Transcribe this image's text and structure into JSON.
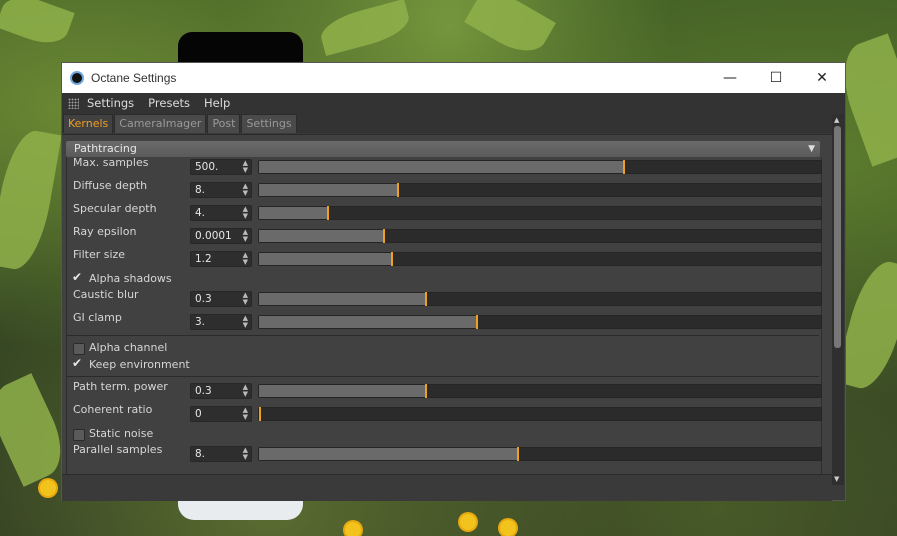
{
  "window": {
    "title": "Octane Settings",
    "minimize_icon": "minimize-icon",
    "maximize_icon": "maximize-icon",
    "close_icon": "close-icon"
  },
  "menu": [
    "Settings",
    "Presets",
    "Help"
  ],
  "tabs": [
    {
      "label": "Kernels",
      "active": true
    },
    {
      "label": "CameraImager",
      "active": false
    },
    {
      "label": "Post",
      "active": false
    },
    {
      "label": "Settings",
      "active": false
    }
  ],
  "group": {
    "title": "Pathtracing"
  },
  "params": {
    "max_samples": {
      "label": "Max. samples",
      "value": "500.",
      "fill": 0.65
    },
    "diffuse_depth": {
      "label": "Diffuse depth",
      "value": "8.",
      "fill": 0.247
    },
    "specular_depth": {
      "label": "Specular depth",
      "value": "4.",
      "fill": 0.123
    },
    "ray_epsilon": {
      "label": "Ray epsilon",
      "value": "0.0001",
      "fill": 0.222
    },
    "filter_size": {
      "label": "Filter size",
      "value": "1.2",
      "fill": 0.237
    },
    "caustic_blur": {
      "label": "Caustic blur",
      "value": "0.3",
      "fill": 0.297
    },
    "gi_clamp": {
      "label": "GI clamp",
      "value": "3.",
      "fill": 0.388
    },
    "path_term": {
      "label": "Path term. power",
      "value": "0.3",
      "fill": 0.297
    },
    "coherent_ratio": {
      "label": "Coherent ratio",
      "value": "0",
      "fill": 0.0
    },
    "parallel": {
      "label": "Parallel samples",
      "value": "8.",
      "fill": 0.46
    }
  },
  "checks": {
    "alpha_shadows": {
      "label": "Alpha shadows",
      "checked": true
    },
    "alpha_channel": {
      "label": "Alpha channel",
      "checked": false
    },
    "keep_environment": {
      "label": "Keep environment",
      "checked": true
    },
    "static_noise": {
      "label": "Static noise",
      "checked": false
    }
  },
  "colors": {
    "accent": "#f0a020",
    "panel": "#414141"
  }
}
